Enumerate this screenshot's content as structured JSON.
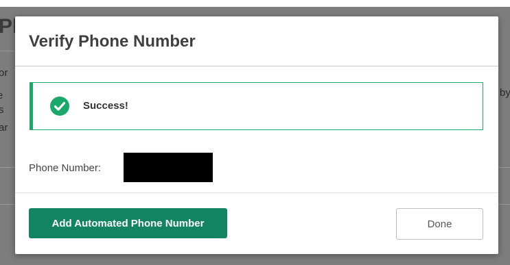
{
  "background": {
    "heading_fragment": "Pl",
    "left_text_fragments": [
      "or",
      "e",
      "s",
      "ar"
    ],
    "right_text_fragment": "by"
  },
  "modal": {
    "title": "Verify Phone Number",
    "alert": {
      "icon": "check-circle-icon",
      "status": "success",
      "message": "Success!"
    },
    "phone": {
      "label": "Phone Number:",
      "value": "",
      "redacted": true
    },
    "buttons": {
      "add_automated": "Add Automated Phone Number",
      "done": "Done"
    }
  },
  "colors": {
    "success_green": "#1aa86b",
    "primary_button": "#138462",
    "overlay": "#7d7d7d"
  }
}
